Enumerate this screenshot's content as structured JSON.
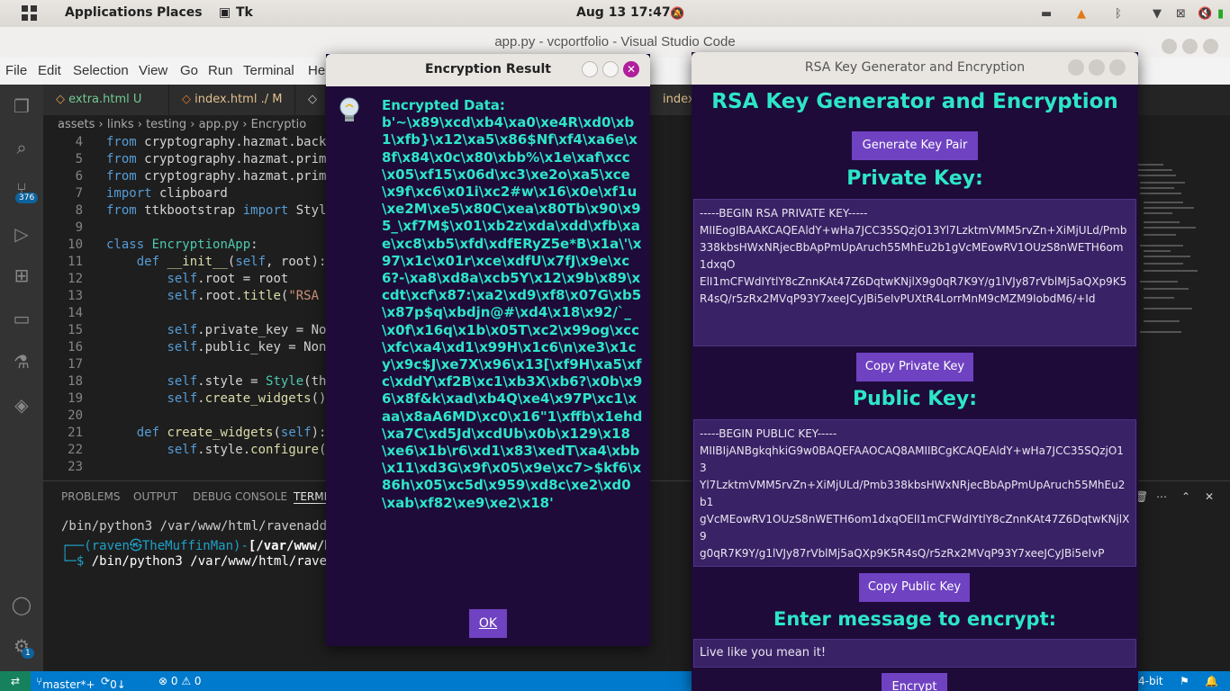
{
  "topbar": {
    "applications": "Applications",
    "places": "Places",
    "tk": "Tk",
    "clock": "Aug 13  17:47"
  },
  "vscode": {
    "title": "app.py - vcportfolio - Visual Studio Code",
    "menu": [
      "File",
      "Edit",
      "Selection",
      "View",
      "Go",
      "Run",
      "Terminal",
      "He"
    ],
    "tabs": [
      "extra.html U",
      "index.html  ./ M",
      "index"
    ],
    "breadcrumb": "assets › links › testing › app.py › Encryptio",
    "scm_badge": "376",
    "settings_badge": "1",
    "code": [
      {
        "n": "4",
        "t": "from cryptography.hazmat.back"
      },
      {
        "n": "5",
        "t": "from cryptography.hazmat.prim"
      },
      {
        "n": "6",
        "t": "from cryptography.hazmat.prim"
      },
      {
        "n": "7",
        "t": "import clipboard"
      },
      {
        "n": "8",
        "t": "from ttkbootstrap import Styl"
      },
      {
        "n": "9",
        "t": ""
      },
      {
        "n": "10",
        "t": "class EncryptionApp:"
      },
      {
        "n": "11",
        "t": "    def __init__(self, root):"
      },
      {
        "n": "12",
        "t": "        self.root = root"
      },
      {
        "n": "13",
        "t": "        self.root.title(\"RSA"
      },
      {
        "n": "14",
        "t": ""
      },
      {
        "n": "15",
        "t": "        self.private_key = No"
      },
      {
        "n": "16",
        "t": "        self.public_key = Non"
      },
      {
        "n": "17",
        "t": ""
      },
      {
        "n": "18",
        "t": "        self.style = Style(th"
      },
      {
        "n": "19",
        "t": "        self.create_widgets()"
      },
      {
        "n": "20",
        "t": ""
      },
      {
        "n": "21",
        "t": "    def create_widgets(self):"
      },
      {
        "n": "22",
        "t": "        self.style.configure("
      },
      {
        "n": "23",
        "t": ""
      }
    ],
    "panel_tabs": [
      "PROBLEMS",
      "OUTPUT",
      "DEBUG CONSOLE",
      "TERMI"
    ],
    "terminal": {
      "line1": "/bin/python3 /var/www/html/ravenaddam",
      "prompt_user": "(raven㉿TheMuffinMan)",
      "prompt_path": "[/var/www/ht",
      "line3_cmd": "/bin/python3 /var/www/html/ravena"
    },
    "status": {
      "branch": "master*+",
      "sync": "0↓ 1↑",
      "problems": "⊗ 0 ⚠ 0",
      "right": "4-bit"
    }
  },
  "dialog": {
    "title": "Encryption Result",
    "label": "Encrypted Data:",
    "encrypted_data": "b'~\\x89\\xcd\\xb4\\xa0\\xe4R\\xd0\\xb1\\xfb}\\x12\\xa5\\x86$Nf\\xf4\\xa6e\\x8f\\x84\\x0c\\x80\\xbb%\\x1e\\xaf\\xcc\\x05\\xf15\\x06d\\xc3\\xe2o\\xa5\\xce\\x9f\\xc6\\x01i\\xc2#w\\x16\\x0e\\xf1u\\xe2M\\xe5\\x80C\\xea\\x80Tb\\x90\\x95_\\xf7M$\\x01\\xb2z\\xda\\xdd\\xfb\\xae\\xc8\\xb5\\xfd\\xdfERyZ5e*B\\x1a\\'\\x97\\x1c\\x01r\\xce\\xdfU\\x7fJ\\x9e\\xc6?-\\xa8\\xd8a\\xcb5Y\\x12\\x9b\\x89\\xcdt\\xcf\\x87:\\xa2\\xd9\\xf8\\x07G\\xb5\\x87p$q\\xbdjn@#\\xd4\\x18\\x92/`_\\x0f\\x16q\\x1b\\x05T\\xc2\\x99og\\xcc\\xfc\\xa4\\xd1\\x99H\\x1c6\\n\\xe3\\x1cy\\x9c$J\\xe7X\\x96\\x13[\\xf9H\\xa5\\xfc\\xddY\\xf2B\\xc1\\xb3X\\xb6?\\x0b\\x96\\x8f&k\\xad\\xb4Q\\xe4\\x97P\\xc1\\xaa\\x8aA6MD\\xc0\\x16\"1\\xffb\\x1ehd\\xa7C\\xd5Jd\\xcdUb\\x0b\\x129\\x18\\xe6\\x1b\\r6\\xd1\\x83\\xedT\\xa4\\xbb\\x11\\xd3G\\x9f\\x05\\x9e\\xc7>$kf6\\x86h\\x05\\xc5d\\x959\\xd8c\\xe2\\xd0\\xab\\xf82\\xe9\\xe2\\x18'",
    "ok_label": "OK"
  },
  "rsa_app": {
    "window_title": "RSA Key Generator and Encryption",
    "heading": "RSA Key Generator and Encryption",
    "generate_button": "Generate Key Pair",
    "private_heading": "Private Key:",
    "private_key": "-----BEGIN RSA PRIVATE KEY-----\nMIIEogIBAAKCAQEAldY+wHa7JCC35SQzjO13Yl7LzktmVMM5rvZn+XiMjULd/Pmb\n338kbsHWxNRjecBbApPmUpAruch55MhEu2b1gVcMEowRV1OUzS8nWETH6om1dxqO\nElI1mCFWdIYtlY8cZnnKAt47Z6DqtwKNjlX9g0qR7K9Y/g1lVJy87rVblMj5aQXp9K5R4sQ/r5zRx2MVqP93Y7xeeJCyJBi5eIvPUXtR4LorrMnM9cMZM9IobdM6/+Id",
    "copy_private": "Copy Private Key",
    "public_heading": "Public Key:",
    "public_key": "-----BEGIN PUBLIC KEY-----\nMIIBIjANBgkqhkiG9w0BAQEFAAOCAQ8AMIIBCgKCAQEAldY+wHa7JCC35SQzjO13\nYl7LzktmVMM5rvZn+XiMjULd/Pmb338kbsHWxNRjecBbApPmUpAruch55MhEu2b1\ngVcMEowRV1OUzS8nWETH6om1dxqOElI1mCFWdIYtlY8cZnnKAt47Z6DqtwKNjlX9\ng0qR7K9Y/g1lVJy87rVblMj5aQXp9K5R4sQ/r5zRx2MVqP93Y7xeeJCyJBi5eIvP",
    "copy_public": "Copy Public Key",
    "message_heading": "Enter message to encrypt:",
    "message_value": "Live like you mean it!",
    "encrypt_button": "Encrypt"
  }
}
